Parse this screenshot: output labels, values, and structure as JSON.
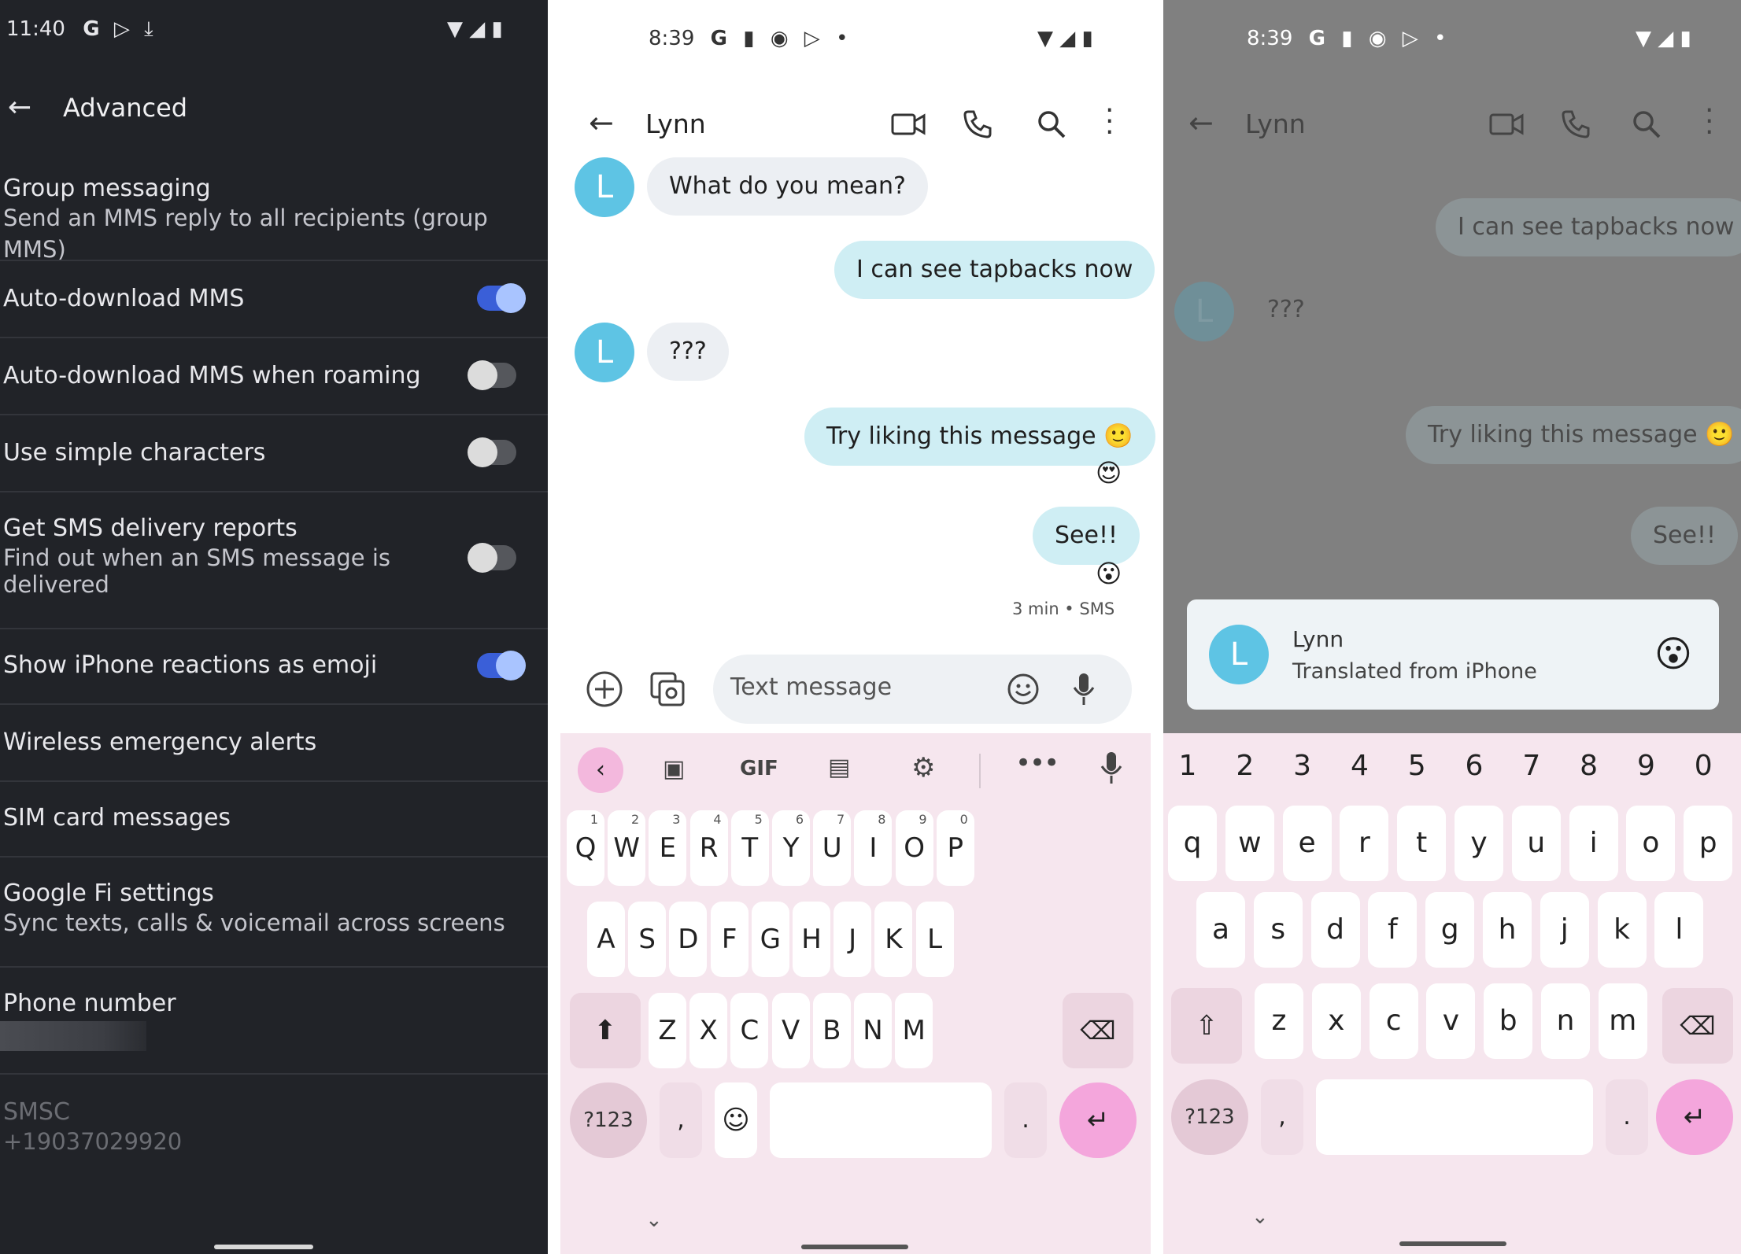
{
  "panel1": {
    "status": {
      "time": "11:40",
      "icons": [
        "google-g-icon",
        "play-store-icon",
        "download-icon"
      ],
      "right_icons": [
        "wifi-icon",
        "signal-icon",
        "battery-icon"
      ]
    },
    "header": {
      "title": "Advanced"
    },
    "settings": [
      {
        "title": "Group messaging",
        "subtitle": "Send an MMS reply to all recipients (group MMS)"
      },
      {
        "title": "Auto-download MMS",
        "toggle": "on"
      },
      {
        "title": "Auto-download MMS when roaming",
        "toggle": "off"
      },
      {
        "title": "Use simple characters",
        "toggle": "off"
      },
      {
        "title": "Get SMS delivery reports",
        "subtitle_line1": "Find out when an SMS message is",
        "subtitle_line2": "delivered",
        "toggle": "off"
      },
      {
        "title": "Show iPhone reactions as emoji",
        "toggle": "on"
      },
      {
        "title": "Wireless emergency alerts"
      },
      {
        "title": "SIM card messages"
      },
      {
        "title": "Google Fi settings",
        "subtitle": "Sync texts, calls & voicemail across screens"
      },
      {
        "title": "Phone number"
      },
      {
        "title": "SMSC",
        "subtitle": "+19037029920"
      }
    ]
  },
  "panel2": {
    "status": {
      "time": "8:39"
    },
    "header": {
      "contact": "Lynn"
    },
    "avatar_letter": "L",
    "messages": [
      {
        "dir": "in",
        "text": "What do you mean?"
      },
      {
        "dir": "out",
        "text": "I can see tapbacks now"
      },
      {
        "dir": "in",
        "text": "???"
      },
      {
        "dir": "out",
        "text": "Try liking this message 🙂",
        "reaction": "😍"
      },
      {
        "dir": "out",
        "text": "See!!",
        "reaction": "😮"
      }
    ],
    "meta": "3 min • SMS",
    "compose": {
      "placeholder": "Text message"
    },
    "toolbar": {
      "gif": "GIF"
    },
    "keyboard": {
      "row1": [
        "Q",
        "W",
        "E",
        "R",
        "T",
        "Y",
        "U",
        "I",
        "O",
        "P"
      ],
      "row1_hints": [
        "1",
        "2",
        "3",
        "4",
        "5",
        "6",
        "7",
        "8",
        "9",
        "0"
      ],
      "row2": [
        "A",
        "S",
        "D",
        "F",
        "G",
        "H",
        "J",
        "K",
        "L"
      ],
      "row3": [
        "Z",
        "X",
        "C",
        "V",
        "B",
        "N",
        "M"
      ],
      "symbols": "?123",
      "comma": ",",
      "period": "."
    }
  },
  "panel3": {
    "status": {
      "time": "8:39"
    },
    "header": {
      "contact": "Lynn"
    },
    "messages_dim": [
      {
        "dir": "out",
        "text": "I can see tapbacks now"
      },
      {
        "dir": "in",
        "text": "???"
      },
      {
        "dir": "out",
        "text": "Try liking this message 🙂"
      },
      {
        "dir": "out",
        "text": "See!!"
      }
    ],
    "popup": {
      "name": "Lynn",
      "subtitle": "Translated from iPhone",
      "avatar_letter": "L",
      "reaction": "😮"
    },
    "keyboard": {
      "numbers": [
        "1",
        "2",
        "3",
        "4",
        "5",
        "6",
        "7",
        "8",
        "9",
        "0"
      ],
      "row1": [
        "q",
        "w",
        "e",
        "r",
        "t",
        "y",
        "u",
        "i",
        "o",
        "p"
      ],
      "row2": [
        "a",
        "s",
        "d",
        "f",
        "g",
        "h",
        "j",
        "k",
        "l"
      ],
      "row3": [
        "z",
        "x",
        "c",
        "v",
        "b",
        "n",
        "m"
      ],
      "symbols": "?123",
      "comma": ",",
      "period": "."
    }
  },
  "colors": {
    "dark_bg": "#212328",
    "accent_blue": "#3a5fd8",
    "avatar": "#5ec4e4",
    "out_bubble": "#cfeef4",
    "kb_pink": "#f6e6ee",
    "enter_pink": "#f4a6dc"
  }
}
